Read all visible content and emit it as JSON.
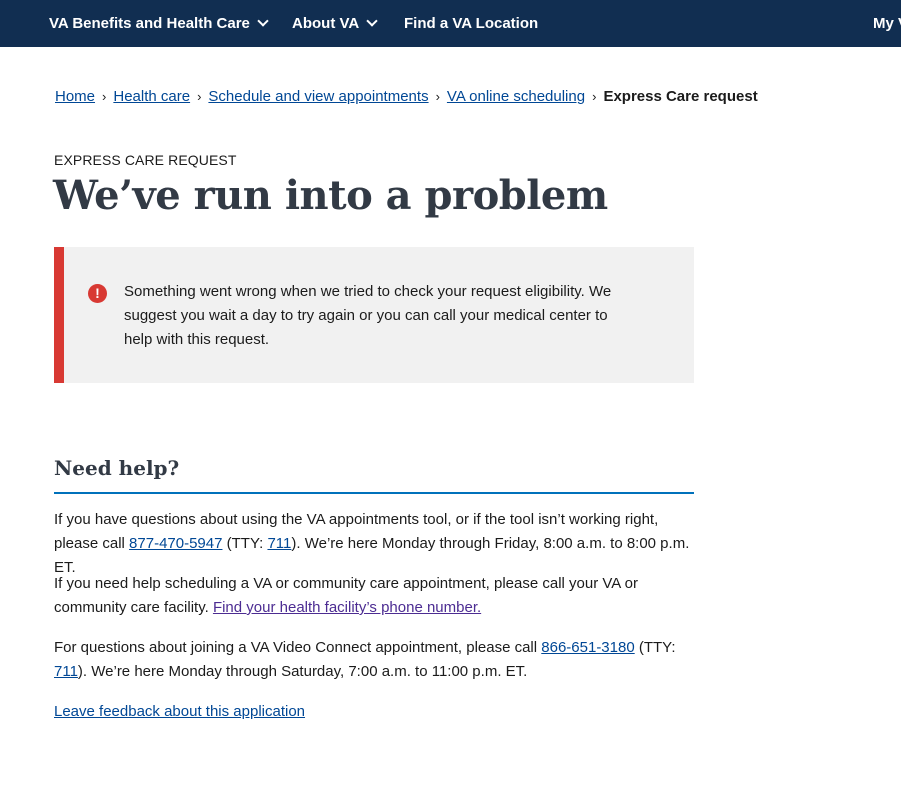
{
  "nav": {
    "benefits": "VA Benefits and Health Care",
    "about": "About VA",
    "find": "Find a VA Location",
    "my_va": "My VA"
  },
  "breadcrumb": {
    "home": "Home",
    "health_care": "Health care",
    "schedule": "Schedule and view appointments",
    "online_scheduling": "VA online scheduling",
    "current": "Express Care request",
    "separator": "›"
  },
  "page": {
    "eyebrow": "EXPRESS CARE REQUEST",
    "title": "We’ve run into a problem"
  },
  "alert": {
    "icon": "!",
    "message": "Something went wrong when we tried to check your request eligibility. We suggest you wait a day to try again or you can call your medical center to help with this request."
  },
  "help": {
    "heading": "Need help?",
    "para1": {
      "before": "If you have questions about using the VA appointments tool, or if the tool isn’t working right, please call ",
      "phone": "877-470-5947",
      "tty_prefix": " (TTY: ",
      "tty": "711",
      "after": "). We’re here Monday through Friday, 8:00 a.m. to 8:00 p.m. ET."
    },
    "para2": {
      "before": "If you need help scheduling a VA or community care appointment, please call your VA or community care facility. ",
      "link": "Find your health facility’s phone number."
    },
    "para3": {
      "before": "For questions about joining a VA Video Connect appointment, please call ",
      "phone": "866-651-3180",
      "tty_prefix": " (TTY: ",
      "tty": "711",
      "after": "). We’re here Monday through Saturday, 7:00 a.m. to 11:00 p.m. ET."
    },
    "feedback": "Leave feedback about this application"
  }
}
